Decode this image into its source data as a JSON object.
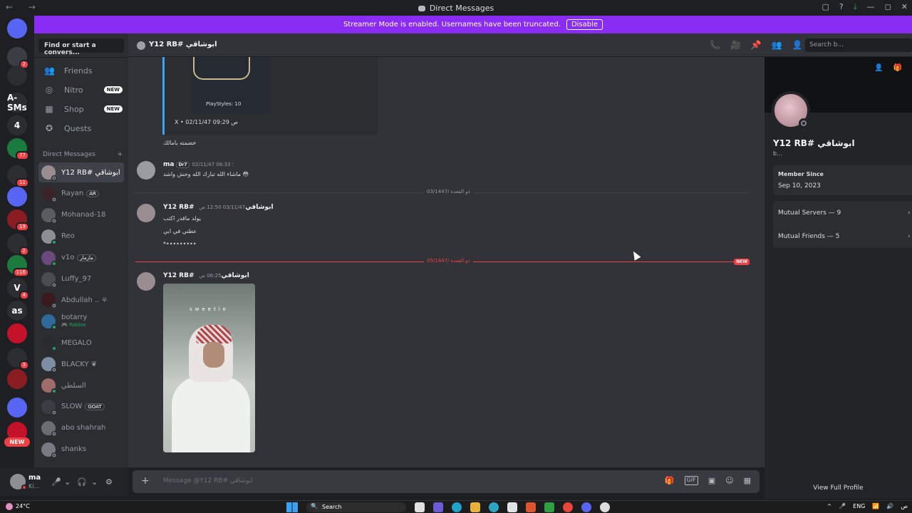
{
  "window": {
    "title": "Direct Messages",
    "nav_back": "←",
    "nav_forward": "→",
    "controls": [
      "▢",
      "?",
      "⤓",
      "—",
      "◻",
      "✕"
    ]
  },
  "streamer": {
    "message": "Streamer Mode is enabled. Usernames have been truncated.",
    "disable_label": "Disable"
  },
  "servers": [
    {
      "label": "",
      "badge": "",
      "color": "#5865f2"
    },
    {
      "label": "",
      "badge": "2",
      "color": "#3b3d44"
    },
    {
      "label": "",
      "badge": "",
      "color": "#2b2d31"
    },
    {
      "label": "A-SMs",
      "badge": "",
      "color": "#2b2d31"
    },
    {
      "label": "4",
      "badge": "",
      "color": "#2b2d31"
    },
    {
      "label": "",
      "badge": "77",
      "color": "#1b7a3d"
    },
    {
      "label": "",
      "badge": "11",
      "color": "#2b2d31"
    },
    {
      "label": "",
      "badge": "",
      "color": "#5865f2"
    },
    {
      "label": "",
      "badge": "19",
      "color": "#8a1d22"
    },
    {
      "label": "",
      "badge": "2",
      "color": "#2b2d31"
    },
    {
      "label": "",
      "badge": "116",
      "color": "#1b7a3d"
    },
    {
      "label": "V",
      "badge": "4",
      "color": "#2b2d31"
    },
    {
      "label": "as",
      "badge": "",
      "color": "#2b2d31"
    },
    {
      "label": "",
      "badge": "",
      "color": "#c4122a"
    },
    {
      "label": "",
      "badge": "3",
      "color": "#2b2d31"
    },
    {
      "label": "",
      "badge": "",
      "color": "#8a1d22"
    },
    {
      "label": "",
      "badge": "",
      "color": "#5865f2"
    },
    {
      "label": "",
      "badge": "",
      "color": "#c4122a"
    }
  ],
  "server_new_tag": "NEW",
  "sidebar": {
    "search_placeholder": "Find or start a convers...",
    "nav": [
      {
        "label": "Friends",
        "icon": "👥",
        "tag": ""
      },
      {
        "label": "Nitro",
        "icon": "◎",
        "tag": "NEW"
      },
      {
        "label": "Shop",
        "icon": "▦",
        "tag": "NEW"
      },
      {
        "label": "Quests",
        "icon": "✪",
        "tag": ""
      }
    ],
    "dm_header": "Direct Messages",
    "dm_add": "+",
    "dms": [
      {
        "name": "Y12 RB# ابوشاقي",
        "chip": "",
        "sub": "",
        "status": "off",
        "color": "#9a8d91",
        "active": true
      },
      {
        "name": "Rayan",
        "chip": "AR",
        "sub": "",
        "status": "off",
        "color": "#3a2428"
      },
      {
        "name": "Mohanad-18",
        "chip": "",
        "sub": "",
        "status": "off",
        "color": "#5a5c61"
      },
      {
        "name": "Reo",
        "chip": "",
        "sub": "",
        "status": "on",
        "color": "#8c8f94"
      },
      {
        "name": "v1o",
        "chip": "مازمار",
        "sub": "",
        "status": "on",
        "color": "#6a4a7c"
      },
      {
        "name": "Luffy_97",
        "chip": "",
        "sub": "",
        "status": "off",
        "color": "#4a4c52"
      },
      {
        "name": "Abdullah .. ⛧",
        "chip": "",
        "sub": "",
        "status": "off",
        "color": "#3a1a1c"
      },
      {
        "name": "botarry",
        "chip": "",
        "sub": "🎮 Roblox",
        "status": "on",
        "color": "#2e6b9a"
      },
      {
        "name": "MEGALO",
        "chip": "",
        "sub": "",
        "status": "on",
        "color": "#2a2b2f"
      },
      {
        "name": "BLACKY ❦",
        "chip": "",
        "sub": "",
        "status": "off",
        "color": "#7d8ea4"
      },
      {
        "name": "السلطي",
        "chip": "",
        "sub": "",
        "status": "on",
        "color": "#a06b6b"
      },
      {
        "name": "SLOW",
        "chip": "GOAT",
        "sub": "",
        "status": "off",
        "color": "#3b3d44"
      },
      {
        "name": "abo shahrah",
        "chip": "",
        "sub": "",
        "status": "off",
        "color": "#6b6d72"
      },
      {
        "name": "shanks",
        "chip": "",
        "sub": "",
        "status": "off",
        "color": "#777a80"
      }
    ]
  },
  "user": {
    "name": "ma",
    "status": "Ki...",
    "mic": "🎤",
    "headset": "🎧",
    "settings": "⚙",
    "caret": "⌄"
  },
  "channel": {
    "name": "Y12 RB# ابوشاقي",
    "icons": [
      "📞",
      "🎥",
      "📌",
      "👥",
      "👤"
    ],
    "search_placeholder": "Search b..."
  },
  "chat": {
    "embed_playstyles": "PlayStyles: 10",
    "embed_footer": "X • 02/11/47 09:29 ص",
    "embed_x": "X",
    "msg0_text": "خضمته يامالك",
    "m1": {
      "author": "ma",
      "role": "Dr7",
      "time": "02/11/47 06:33 ؛",
      "text": "ماشاء الله تبارك الله وحش واشد 😳"
    },
    "sep1": "03/1447/ ذو القعدة",
    "m2": {
      "author": "Y12 RB# ابوشاقي",
      "time": "03/11/47 12:50 ص",
      "lines": [
        "يولد ماقدر اكتب",
        "عطني في ابي",
        "*•••••••••"
      ]
    },
    "sep2": "05/1447/ ذو القعدة",
    "new_badge": "NEW",
    "m3": {
      "author": "Y12 RB# ابوشاقي",
      "time": "06:25 ص"
    },
    "photo_watermark": "sweetie"
  },
  "composer": {
    "placeholder": "Message @Y12 RB# ابوشاقي",
    "plus": "+",
    "tools": [
      "🎁",
      "GIF",
      "▣",
      "☺",
      "▦"
    ]
  },
  "profile": {
    "icons": [
      "👤",
      "🎁"
    ],
    "name": "Y12 RB# ابوشاقي",
    "bio": "b...",
    "member_since_label": "Member Since",
    "member_since_value": "Sep 10, 2023",
    "mutual_servers": "Mutual Servers — 9",
    "mutual_friends": "Mutual Friends — 5",
    "chevron": "›",
    "view_full": "View Full Profile"
  },
  "taskbar": {
    "weather": "24°C",
    "search": "Search",
    "lang": "ENG",
    "tray": [
      "^",
      "🎤",
      "ENG",
      "📶",
      "🔊",
      "ص"
    ]
  }
}
